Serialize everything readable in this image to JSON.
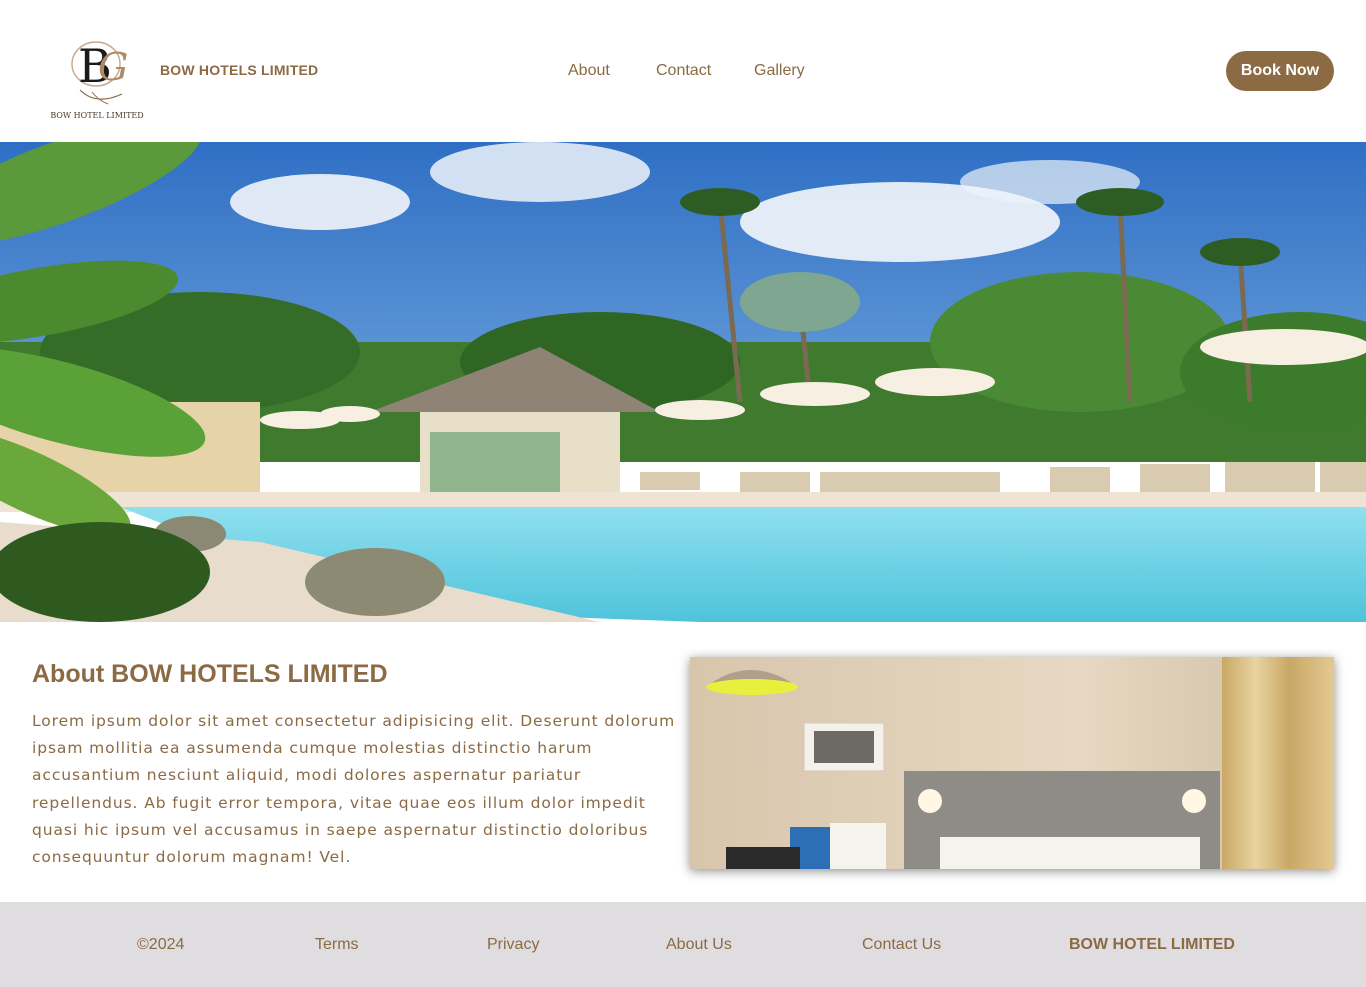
{
  "header": {
    "logo_caption": "BOW HOTEL LIMITED",
    "brand": "BOW HOTELS LIMITED",
    "nav": {
      "about": "About",
      "contact": "Contact",
      "gallery": "Gallery"
    },
    "book_now": "Book Now"
  },
  "about": {
    "title": "About BOW HOTELS LIMITED",
    "text": "Lorem ipsum dolor sit amet consectetur adipisicing elit. Deserunt dolorum ipsam mollitia ea assumenda cumque molestias distinctio harum accusantium nesciunt aliquid, modi dolores aspernatur pariatur repellendus. Ab fugit error tempora, vitae quae eos illum dolor impedit quasi hic ipsum vel accusamus in saepe aspernatur distinctio doloribus consequuntur dolorum magnam! Vel."
  },
  "footer": {
    "copyright": "©2024",
    "terms": "Terms",
    "privacy": "Privacy",
    "about_us": "About Us",
    "contact_us": "Contact Us",
    "brand": "BOW HOTEL LIMITED"
  },
  "colors": {
    "accent": "#8b6a44",
    "footer_bg": "#dfdde0",
    "pool": "#6fd3e6",
    "sky": "#3a78c6"
  },
  "icons": {
    "logo": "bg-monogram-logo"
  }
}
